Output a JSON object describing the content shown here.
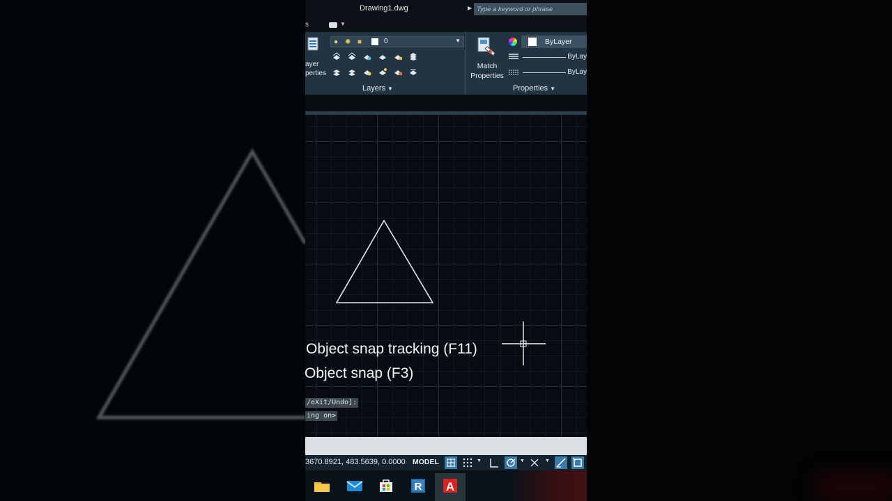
{
  "titlebar": {
    "title": "Drawing1.dwg",
    "search_placeholder": "Type a keyword or phrase"
  },
  "tabrow": {
    "partial_tab": "s"
  },
  "ribbon": {
    "layers_panel": {
      "title": "Layers",
      "layer_properties_label_line1": "ayer",
      "layer_properties_label_line2": "perties",
      "current_layer": "0"
    },
    "properties_panel": {
      "title": "Properties",
      "match_properties_line1": "Match",
      "match_properties_line2": "Properties",
      "color_value": "ByLayer",
      "linetype_value": "ByLay",
      "lineweight_value": "ByLay"
    }
  },
  "canvas": {
    "tooltip_lines": [
      "Object snap tracking (F11)",
      "Object snap (F3)"
    ],
    "command_history": [
      "/eXit/Undo]:",
      "ing on>"
    ]
  },
  "statusbar": {
    "coordinates": "3670.8921, 483.5639, 0.0000",
    "model_label": "MODEL"
  },
  "taskbar": {
    "apps": [
      "file-explorer-icon",
      "mail-icon",
      "store-icon",
      "revit-icon",
      "autocad-icon"
    ],
    "revit_letter": "R",
    "autocad_letter": "A"
  },
  "colors": {
    "ribbon_bg": "#223442",
    "canvas_bg": "#080b11",
    "statusbar_bg": "#13222d",
    "active_toggle": "#3a7aa8",
    "autocad_red": "#d92323"
  }
}
